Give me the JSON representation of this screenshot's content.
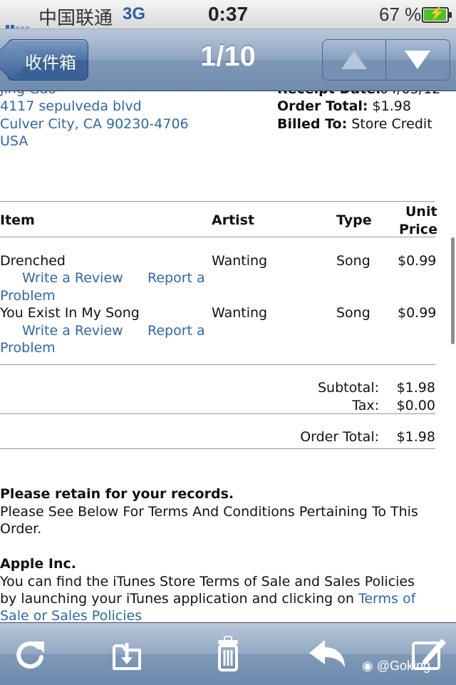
{
  "status_bar": {
    "carrier": "中国联通",
    "network": "3G",
    "time": "0:37",
    "battery_pct": "67 %"
  },
  "nav": {
    "back_label": "收件箱",
    "title": "1/10"
  },
  "receipt": {
    "partial_name": "Jing Gao",
    "address_line1": "4117 sepulveda blvd",
    "address_line2": "Culver City, CA 90230-4706",
    "country": "USA",
    "partial_date_label": "Receipt Date:",
    "partial_date_value": "04/05/12",
    "order_total_label": "Order Total:",
    "order_total_value": "$1.98",
    "billed_to_label": "Billed To:",
    "billed_to_value": "Store Credit"
  },
  "table": {
    "headers": {
      "item": "Item",
      "artist": "Artist",
      "type": "Type",
      "unit_price_1": "Unit",
      "unit_price_2": "Price"
    },
    "rows": [
      {
        "item": "Drenched",
        "artist": "Wanting",
        "type": "Song",
        "price": "$0.99",
        "review": "Write a Review",
        "report1": "Report a",
        "report2": "Problem"
      },
      {
        "item": "You Exist In My Song",
        "artist": "Wanting",
        "type": "Song",
        "price": "$0.99",
        "review": "Write a Review",
        "report1": "Report a",
        "report2": "Problem"
      }
    ]
  },
  "totals": {
    "subtotal_label": "Subtotal:",
    "subtotal_value": "$1.98",
    "tax_label": "Tax:",
    "tax_value": "$0.00",
    "order_total_label": "Order Total:",
    "order_total_value": "$1.98"
  },
  "notes": {
    "retain_heading": "Please retain for your records.",
    "retain_line1": "Please See Below For Terms And Conditions Pertaining To This",
    "retain_line2": "Order.",
    "company": "Apple Inc.",
    "terms_line1": "You can find the iTunes Store Terms of Sale and Sales Policies",
    "terms_line2_prefix": "by launching your iTunes application and clicking on",
    "terms_link_part1": "Terms of",
    "terms_link_part2": "Sale or Sales Policies"
  },
  "toolbar": {
    "icons": [
      "refresh-icon",
      "move-to-folder-icon",
      "trash-icon",
      "reply-icon",
      "compose-icon"
    ],
    "watermark": "@Goking"
  },
  "colors": {
    "link": "#2e68a8",
    "nav_bar": "#7e98b8",
    "battery": "#4cc12c"
  }
}
